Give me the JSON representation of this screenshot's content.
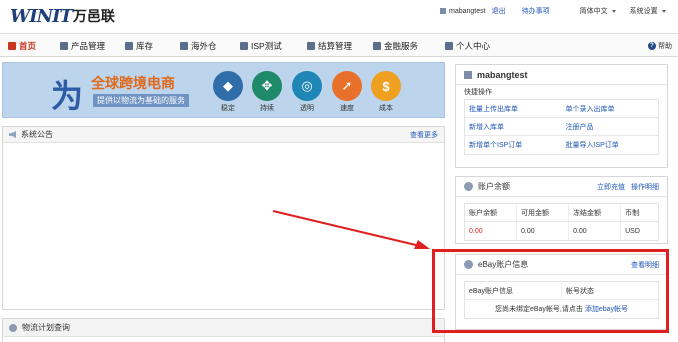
{
  "header": {
    "logo_mark": "WINIT",
    "logo_cn": "万邑联",
    "username": "mabangtest",
    "logout": "退出",
    "todo": "待办事项",
    "language": "简体中文",
    "settings": "系统设置"
  },
  "nav": {
    "items": [
      {
        "label": "首页",
        "icon": "home-icon"
      },
      {
        "label": "产品管理",
        "icon": "grid-icon"
      },
      {
        "label": "库存",
        "icon": "truck-icon"
      },
      {
        "label": "海外仓",
        "icon": "warehouse-icon"
      },
      {
        "label": "ISP测试",
        "icon": "plane-icon"
      },
      {
        "label": "结算管理",
        "icon": "table-icon"
      },
      {
        "label": "金融服务",
        "icon": "coin-icon"
      },
      {
        "label": "个人中心",
        "icon": "user-icon"
      }
    ],
    "help": "帮助"
  },
  "banner": {
    "wei": "为",
    "title": "全球跨境电商",
    "subtitle": "提供以物流为基础的服务",
    "features": [
      {
        "label": "稳定",
        "color": "#2f6ea8",
        "icon": "shield-icon",
        "glyph": "◆"
      },
      {
        "label": "持续",
        "color": "#1f8a6a",
        "icon": "arrows-icon",
        "glyph": "✥"
      },
      {
        "label": "透明",
        "color": "#1f86b5",
        "icon": "magnifier-icon",
        "glyph": "◎"
      },
      {
        "label": "速度",
        "color": "#e8702a",
        "icon": "rocket-icon",
        "glyph": "➚"
      },
      {
        "label": "成本",
        "color": "#f0a020",
        "icon": "dollar-icon",
        "glyph": "$"
      }
    ]
  },
  "announcement": {
    "title": "系统公告",
    "more": "查看更多"
  },
  "logistics_plan": {
    "title": "物流计划查询"
  },
  "user_panel": {
    "name": "mabangtest",
    "quick_ops": "快捷操作",
    "links": [
      [
        "批量上传出库单",
        "单个录入出库单"
      ],
      [
        "新增入库单",
        "注册产品"
      ],
      [
        "新增单个ISP订单",
        "批量导入ISP订单"
      ]
    ]
  },
  "balance": {
    "title": "账户余额",
    "recharge": "立即充值",
    "guide": "操作明细",
    "headers": [
      "账户余额",
      "可用金额",
      "冻结金额",
      "币制"
    ],
    "row": [
      "0.00",
      "0.00",
      "0.00",
      "USD"
    ]
  },
  "ebay": {
    "title": "eBay账户信息",
    "detail": "查看明细",
    "headers": [
      "eBay账户信息",
      "帐号状态"
    ],
    "empty_text": "您尚未绑定eBay帐号,请点击",
    "add_link": "添加ebay帐号"
  },
  "colors": {
    "brand": "#1d3e78",
    "active_nav": "#c7351f",
    "link": "#1f56b8",
    "annotation": "#e02020"
  }
}
